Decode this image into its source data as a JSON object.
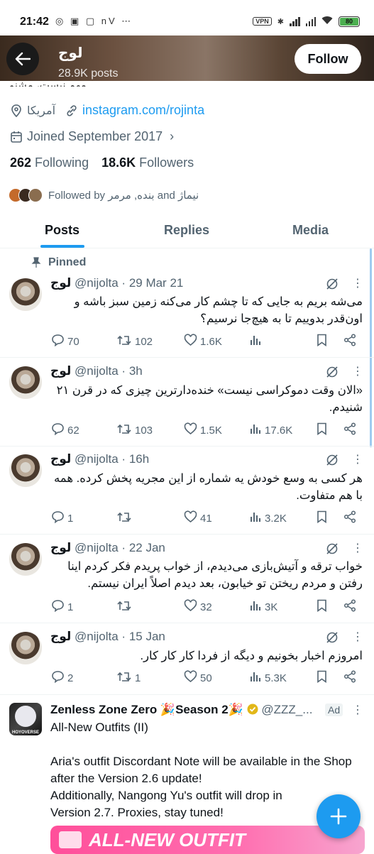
{
  "status_bar": {
    "time": "21:42",
    "left_icons": "◎ ▣ ▢ nV ⋯",
    "vpn": "VPN",
    "battery": "80"
  },
  "header": {
    "name": "لوج",
    "posts": "28.9K posts",
    "follow_label": "Follow"
  },
  "profile": {
    "bio_clipped": "مهم نیست، مشنو.",
    "location": "آمریکا",
    "website": "instagram.com/rojinta",
    "joined": "Joined September 2017",
    "following_count": "262",
    "following_label": "Following",
    "followers_count": "18.6K",
    "followers_label": "Followers",
    "followed_by": "Followed by بنده, مرمر and نیماژ"
  },
  "tabs": [
    {
      "label": "Posts"
    },
    {
      "label": "Replies"
    },
    {
      "label": "Media"
    }
  ],
  "pinned_label": "Pinned",
  "tweets": [
    {
      "name": "لوج",
      "meta": "@nijolta · 29 Mar 21",
      "text": "می‌شه بریم به جایی که تا چشم کار می‌کنه زمین سبز باشه و اون‌قدر بدوییم تا به هیچ‌جا نرسیم؟",
      "replies": "70",
      "reposts": "102",
      "likes": "1.6K",
      "views": ""
    },
    {
      "name": "لوج",
      "meta": "@nijolta · 3h",
      "text": "«الان وقت دموکراسی نیست» خنده‌دارترین چیزی که در قرن ۲۱ شنیدم.",
      "replies": "62",
      "reposts": "103",
      "likes": "1.5K",
      "views": "17.6K"
    },
    {
      "name": "لوج",
      "meta": "@nijolta · 16h",
      "text": "هر کسی به وسع خودش یه شماره از این مجریه پخش کرده. همه با هم متفاوت.",
      "replies": "1",
      "reposts": "",
      "likes": "41",
      "views": "3.2K"
    },
    {
      "name": "لوج",
      "meta": "@nijolta · 22 Jan",
      "text": "خواب ترقه و آتیش‌بازی می‌دیدم، از خواب پریدم فکر کردم اینا رفتن و مردم ریختن تو خیابون، بعد دیدم اصلاً ایران نیستم.",
      "replies": "1",
      "reposts": "",
      "likes": "32",
      "views": "3K"
    },
    {
      "name": "لوج",
      "meta": "@nijolta · 15 Jan",
      "text": "امروزم اخبار بخونیم و دیگه از فردا کار کار کار.",
      "replies": "2",
      "reposts": "1",
      "likes": "50",
      "views": "5.3K"
    }
  ],
  "ad": {
    "name": "Zenless Zone Zero 🎉Season 2🎉",
    "handle": "@ZZZ_...",
    "tag": "Ad",
    "line1": "All-New Outfits (II)",
    "line2": "Aria's outfit Discordant Note will be available in the Shop after the Version 2.6 update!",
    "line3": "Additionally, Nangong Yu's outfit will drop in Version 2.7. Proxies, stay tuned!",
    "banner_text": "ALL-NEW OUTFIT",
    "logo_text": "HOYOVERSE"
  },
  "colors": {
    "accent": "#1d9bf0",
    "text": "#0f1419",
    "muted": "#536471",
    "verified": "#e2b719"
  }
}
